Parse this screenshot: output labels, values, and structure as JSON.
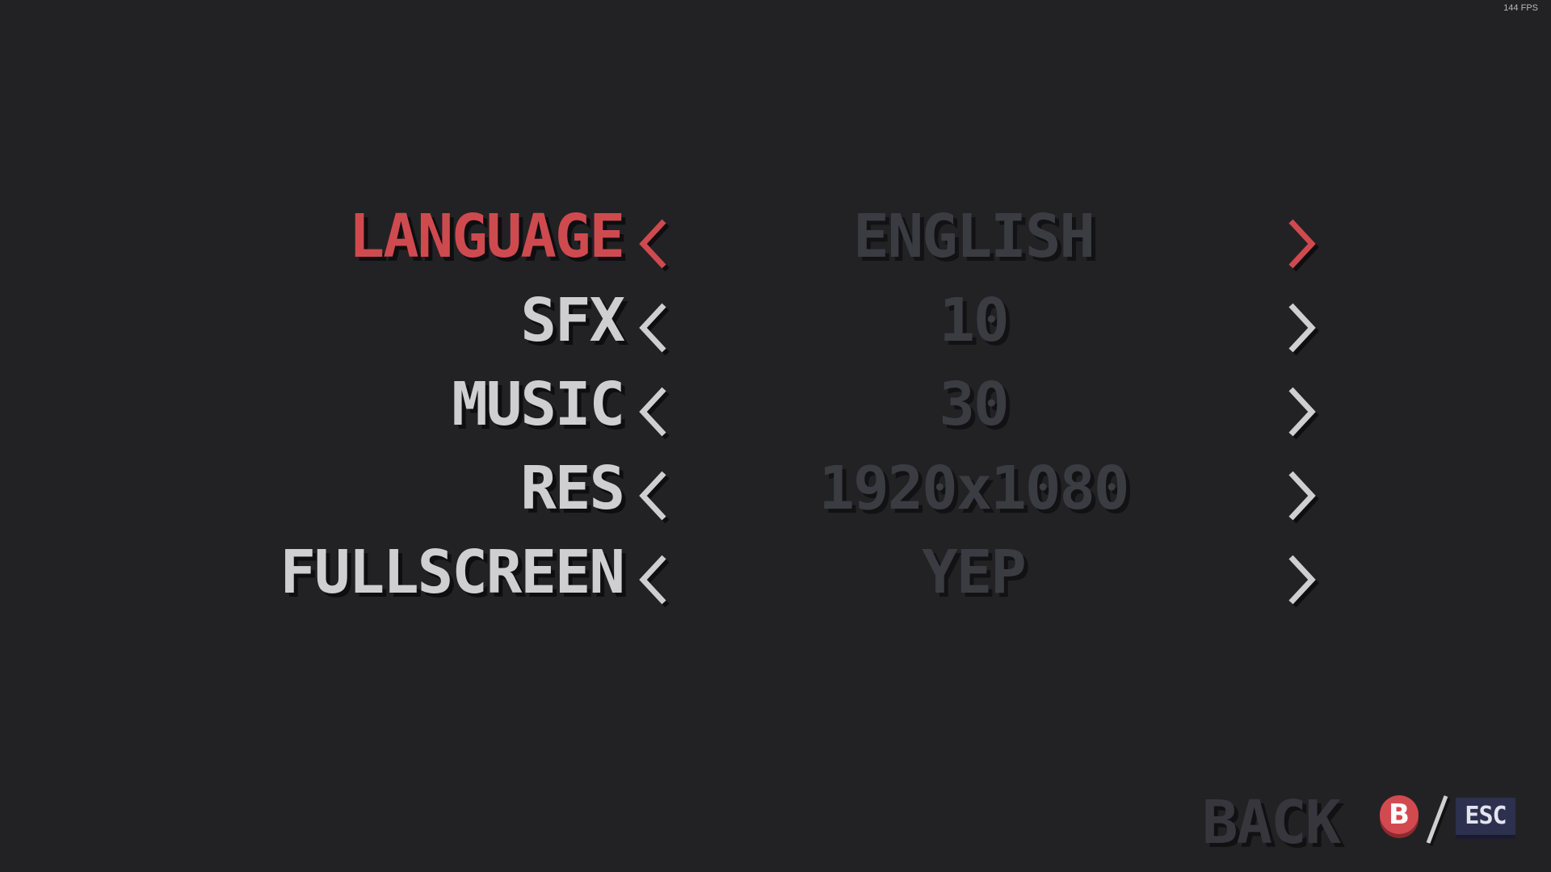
{
  "fps_counter": "144 FPS",
  "colors": {
    "background": "#222225",
    "active": "#cf4a4f",
    "inactive_label": "#cfcfd1",
    "value_text": "#3b3b42"
  },
  "settings": [
    {
      "label": "LANGUAGE",
      "value": "ENGLISH",
      "selected": true
    },
    {
      "label": "SFX",
      "value": "10",
      "selected": false
    },
    {
      "label": "MUSIC",
      "value": "30",
      "selected": false
    },
    {
      "label": "RES",
      "value": "1920x1080",
      "selected": false
    },
    {
      "label": "FULLSCREEN",
      "value": "YEP",
      "selected": false
    }
  ],
  "back": {
    "label": "BACK",
    "gamepad_button": "B",
    "separator": "/",
    "key": "ESC"
  },
  "icons": {
    "left": "chevron-left-icon",
    "right": "chevron-right-icon"
  }
}
